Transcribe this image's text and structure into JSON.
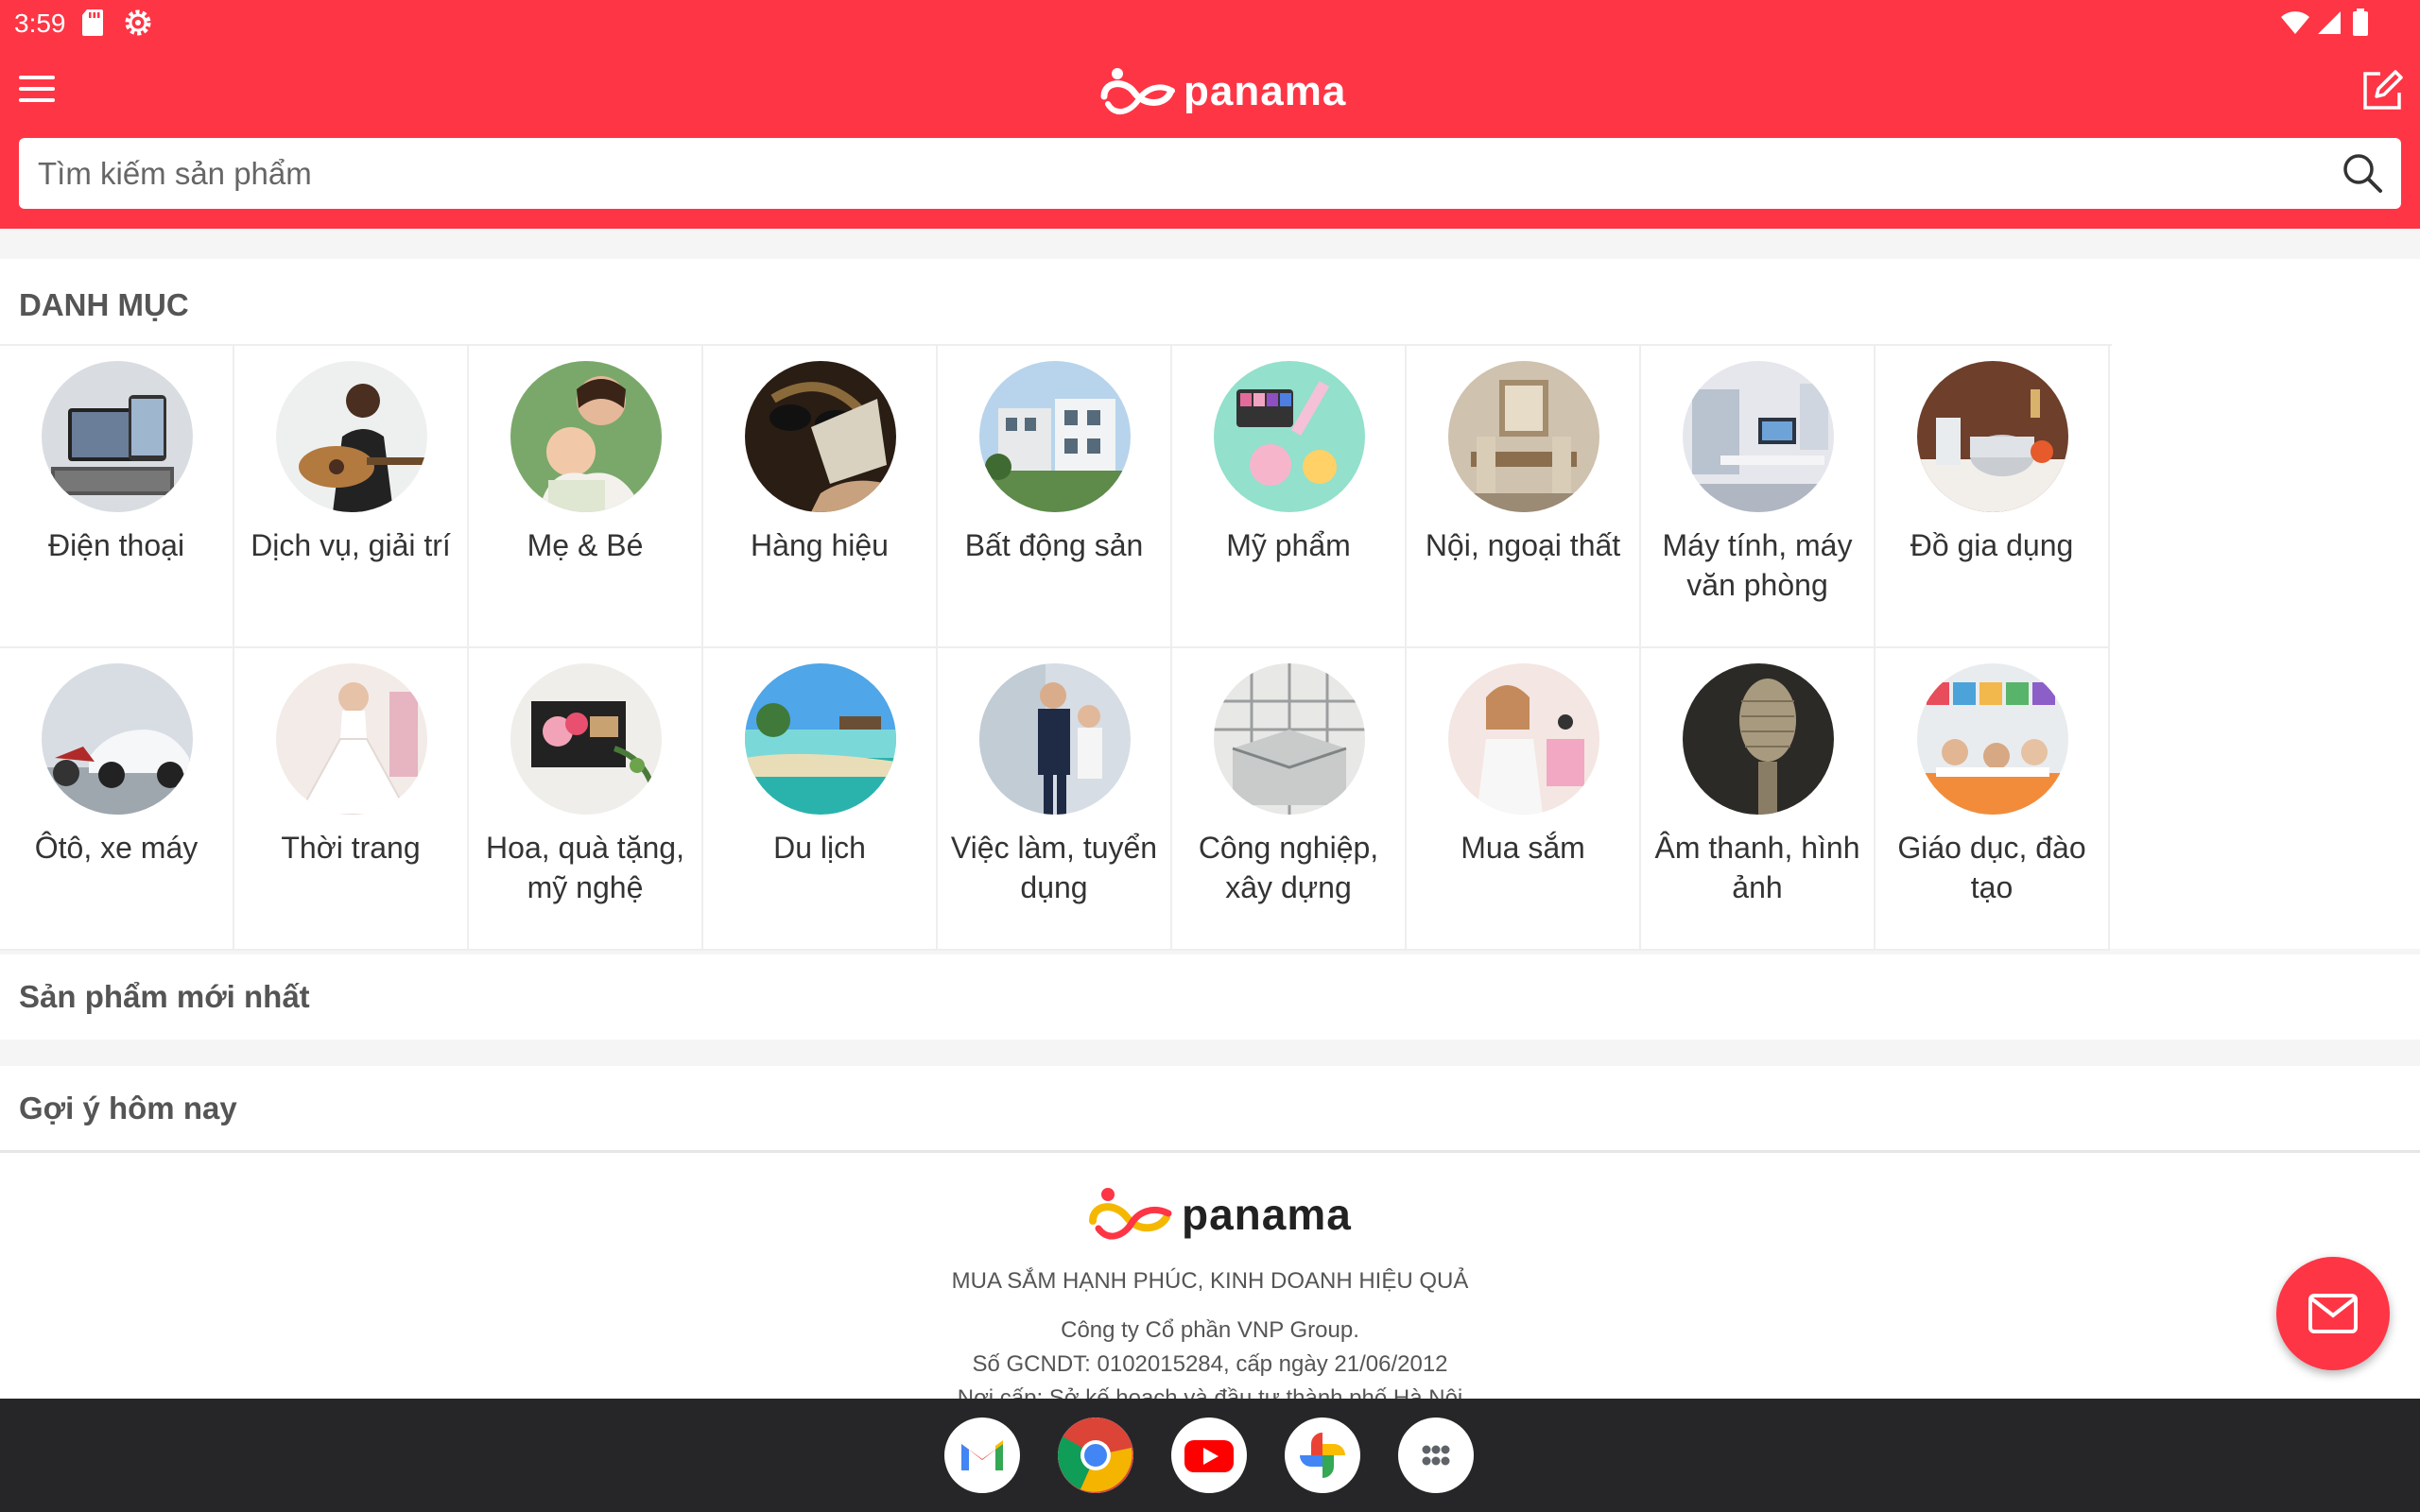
{
  "status_bar": {
    "time": "3:59"
  },
  "app": {
    "logo_text": "panama",
    "search_placeholder": "Tìm kiếm sản phẩm"
  },
  "categories": {
    "title": "DANH MỤC",
    "items": [
      {
        "label": "Điện thoại",
        "image": "smartphones-tablets"
      },
      {
        "label": "Dịch vụ, giải trí",
        "image": "woman-playing-guitar"
      },
      {
        "label": "Mẹ & Bé",
        "image": "mother-and-baby"
      },
      {
        "label": "Hàng hiệu",
        "image": "luxury-sunglasses-bag"
      },
      {
        "label": "Bất động sản",
        "image": "villa-buildings"
      },
      {
        "label": "Mỹ phẩm",
        "image": "cosmetics-makeup"
      },
      {
        "label": "Nội, ngoại thất",
        "image": "dining-room-interior"
      },
      {
        "label": "Máy tính, máy văn phòng",
        "image": "office-desk-computers"
      },
      {
        "label": "Đồ gia dụng",
        "image": "kitchen-appliances"
      },
      {
        "label": "Ôtô, xe máy",
        "image": "car-and-motorbike"
      },
      {
        "label": "Thời trang",
        "image": "bride-dress"
      },
      {
        "label": "Hoa, quà tặng, mỹ nghệ",
        "image": "gift-box-flowers"
      },
      {
        "label": "Du lịch",
        "image": "tropical-beach"
      },
      {
        "label": "Việc làm, tuyển dụng",
        "image": "business-people"
      },
      {
        "label": "Công nghiệp, xây dựng",
        "image": "construction-structure"
      },
      {
        "label": "Mua sắm",
        "image": "shopping-woman"
      },
      {
        "label": "Âm thanh, hình ảnh",
        "image": "studio-microphone"
      },
      {
        "label": "Giáo dục, đào tạo",
        "image": "classroom"
      }
    ]
  },
  "sections": {
    "newest": "Sản phẩm mới nhất",
    "suggest": "Gợi ý hôm nay"
  },
  "footer": {
    "logo_text": "panama",
    "slogan": "MUA SẮM HẠNH PHÚC, KINH DOANH HIỆU QUẢ",
    "company": "Công ty Cổ phần VNP Group.",
    "license": "Số GCNDT: 0102015284, cấp ngày 21/06/2012",
    "issuer": "Nơi cấp: Sở kế hoạch và đầu tư thành phố Hà Nội"
  },
  "dock": {
    "apps": [
      "gmail-icon",
      "chrome-icon",
      "youtube-icon",
      "photos-icon",
      "app-drawer-icon"
    ]
  },
  "colors": {
    "brand": "#fe3545",
    "dock": "#262628"
  }
}
